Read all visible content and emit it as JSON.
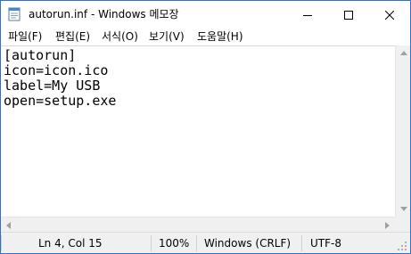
{
  "window": {
    "title": "autorun.inf - Windows 메모장",
    "app_icon": "notepad-icon",
    "controls": {
      "minimize_icon": "minimize-icon",
      "maximize_icon": "maximize-icon",
      "close_icon": "close-icon"
    }
  },
  "menu": {
    "items": [
      {
        "label": "파일(F)"
      },
      {
        "label": "편집(E)"
      },
      {
        "label": "서식(O)"
      },
      {
        "label": "보기(V)"
      },
      {
        "label": "도움말(H)"
      }
    ]
  },
  "editor": {
    "lines": [
      "[autorun]",
      "icon=icon.ico",
      "label=My USB",
      "open=setup.exe"
    ]
  },
  "status": {
    "position": "Ln 4, Col 15",
    "zoom": "100%",
    "line_ending": "Windows (CRLF)",
    "encoding": "UTF-8"
  },
  "colors": {
    "window_border": "#2b74c7",
    "statusbar_bg": "#f0f0f0"
  }
}
